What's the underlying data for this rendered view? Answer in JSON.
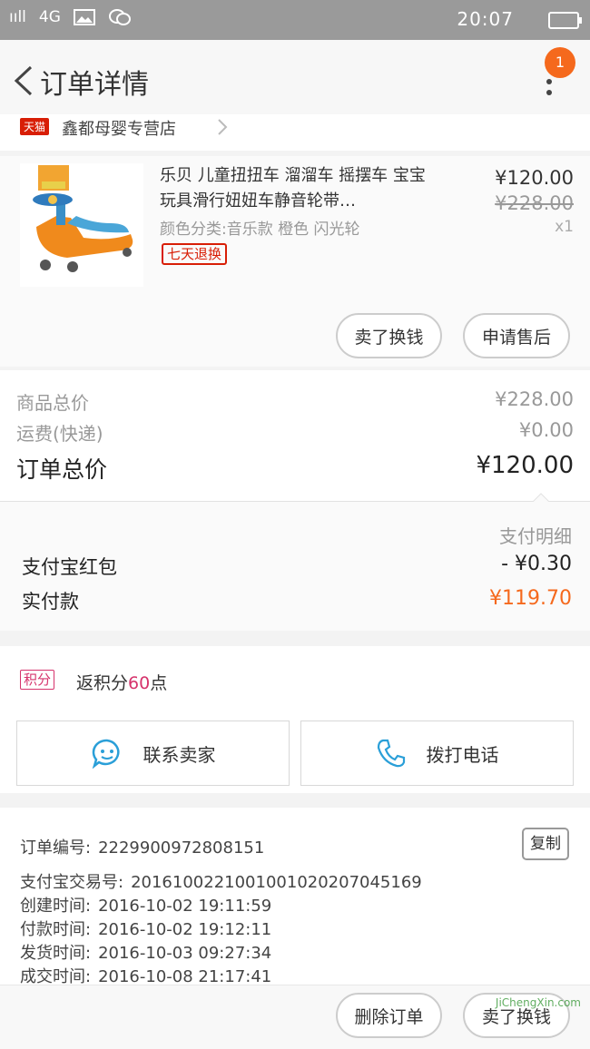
{
  "status_bar": {
    "signal": "ııll",
    "network": "4G",
    "time": "20:07"
  },
  "nav": {
    "title": "订单详情",
    "badge": "1"
  },
  "shop": {
    "badge": "天猫",
    "name": "鑫都母婴专营店"
  },
  "product": {
    "title": "乐贝 儿童扭扭车 溜溜车 摇摆车 宝宝玩具滑行妞妞车静音轮带…",
    "spec": "颜色分类:音乐款 橙色 闪光轮",
    "return_badge": "七天退换",
    "price": "¥120.00",
    "original_price": "¥228.00",
    "quantity": "x1"
  },
  "actions": {
    "remind_label": "卖了换钱",
    "aftersale_label": "申请售后"
  },
  "pricing": {
    "goods_total_label": "商品总价",
    "goods_total_value": "¥228.00",
    "shipping_label": "运费(快递)",
    "shipping_value": "¥0.00",
    "order_total_label": "订单总价",
    "order_total_value": "¥120.00"
  },
  "payment": {
    "detail_label": "支付明细",
    "redpacket_label": "支付宝红包",
    "redpacket_value": "- ¥0.30",
    "paid_label": "实付款",
    "paid_value": "¥119.70"
  },
  "points": {
    "badge": "积分",
    "prefix": "返积分",
    "amount": "60",
    "suffix": "点"
  },
  "contact": {
    "seller_label": "联系卖家",
    "phone_label": "拨打电话"
  },
  "order_info": {
    "order_no_label": "订单编号:",
    "order_no": "2229900972808151",
    "copy_label": "复制",
    "alipay_label": "支付宝交易号:",
    "alipay_no": "2016100221001001020207045169",
    "created_label": "创建时间:",
    "created": "2016-10-02 19:11:59",
    "paid_label": "付款时间:",
    "paid": "2016-10-02 19:12:11",
    "shipped_label": "发货时间:",
    "shipped": "2016-10-03 09:27:34",
    "completed_label": "成交时间:",
    "completed": "2016-10-08 21:17:41"
  },
  "bottom": {
    "delete_label": "删除订单",
    "remind_label": "卖了换钱",
    "watermark": "JiChengXin.com"
  },
  "colors": {
    "accent_orange": "#f5691d",
    "tmall_red": "#d81e06",
    "points_pink": "#d6336c",
    "icon_blue": "#2a9fd8"
  }
}
